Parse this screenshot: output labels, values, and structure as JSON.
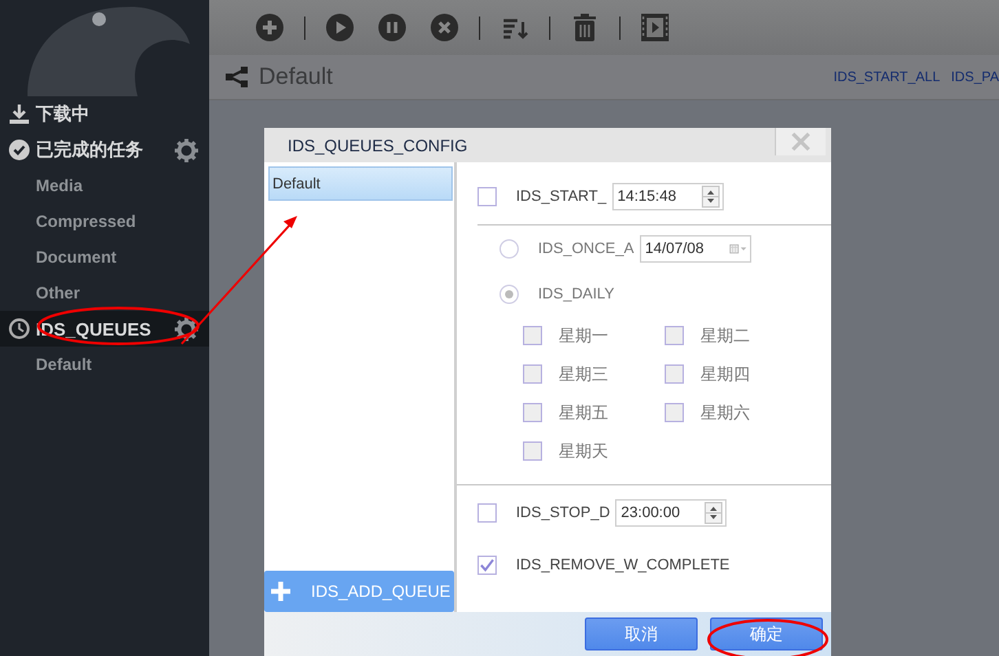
{
  "sidebar": {
    "items": [
      {
        "kind": "downloading",
        "label": "下载中",
        "selected": false,
        "settings": false
      },
      {
        "kind": "finished",
        "label": "已完成的任务",
        "selected": false,
        "settings": true
      },
      {
        "kind": "sub",
        "label": "Media",
        "selected": false,
        "settings": false
      },
      {
        "kind": "sub",
        "label": "Compressed",
        "selected": false,
        "settings": false
      },
      {
        "kind": "sub",
        "label": "Document",
        "selected": false,
        "settings": false
      },
      {
        "kind": "sub",
        "label": "Other",
        "selected": false,
        "settings": false
      },
      {
        "kind": "queues",
        "label": "IDS_QUEUES",
        "selected": true,
        "settings": true
      },
      {
        "kind": "sub",
        "label": "Default",
        "selected": false,
        "settings": false
      }
    ]
  },
  "header": {
    "title": "Default",
    "links": [
      "IDS_START_ALL",
      "IDS_PA"
    ]
  },
  "dialog": {
    "title": "IDS_QUEUES_CONFIG",
    "queues": [
      {
        "label": "Default",
        "selected": true
      }
    ],
    "add_button": "IDS_ADD_QUEUE",
    "start": {
      "label": "IDS_START_",
      "checked": false,
      "value": "14:15:48"
    },
    "schedule": {
      "disabled": true,
      "options": [
        {
          "label": "IDS_ONCE_A",
          "selected": false,
          "value": "14/07/08"
        },
        {
          "label": "IDS_DAILY",
          "selected": true
        }
      ],
      "days": [
        {
          "label": "星期一",
          "checked": false
        },
        {
          "label": "星期二",
          "checked": false
        },
        {
          "label": "星期三",
          "checked": false
        },
        {
          "label": "星期四",
          "checked": false
        },
        {
          "label": "星期五",
          "checked": false
        },
        {
          "label": "星期六",
          "checked": false
        },
        {
          "label": "星期天",
          "checked": false
        }
      ]
    },
    "stop": {
      "label": "IDS_STOP_D",
      "checked": false,
      "value": "23:00:00"
    },
    "remove": {
      "label": "IDS_REMOVE_W_COMPLETE",
      "checked": true
    },
    "buttons": [
      "取消",
      "确定"
    ]
  }
}
